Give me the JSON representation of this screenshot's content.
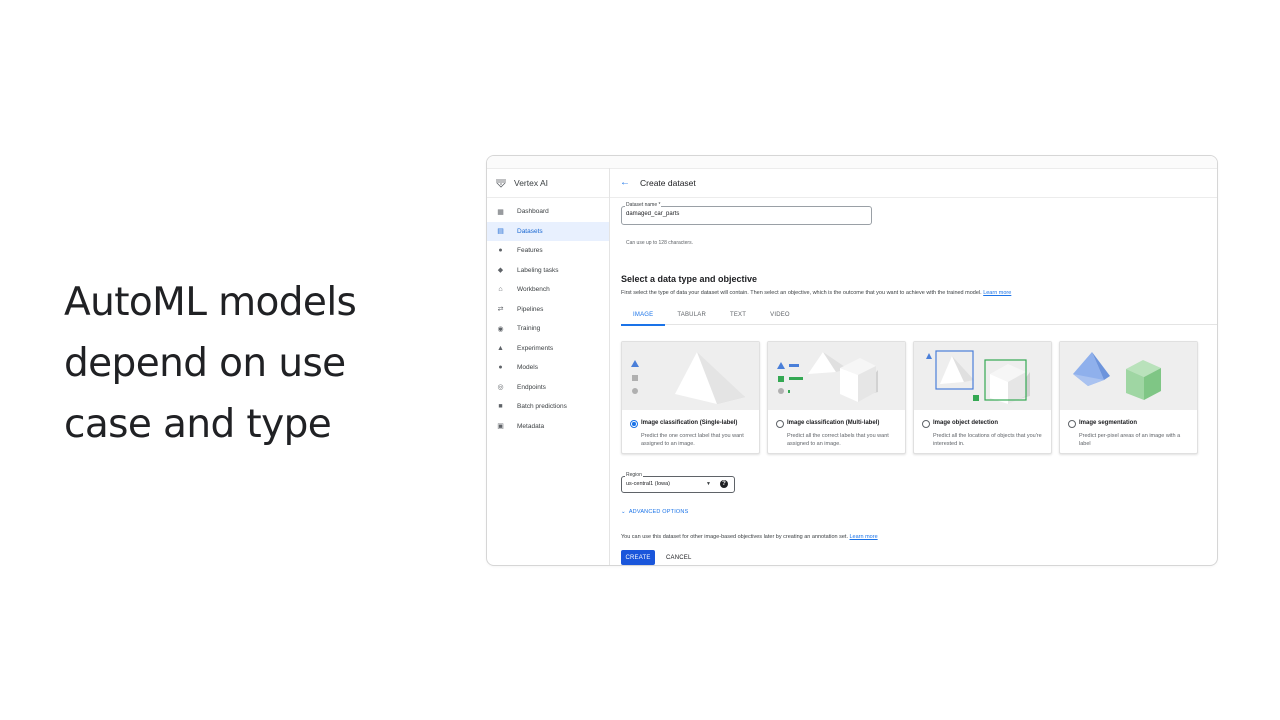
{
  "slide": {
    "headline_lines": [
      "AutoML models",
      "depend on use",
      "case and type"
    ]
  },
  "app": {
    "title": "Vertex AI",
    "accent_color": "#1a73e8"
  },
  "sidebar": {
    "items": [
      {
        "label": "Dashboard",
        "icon": "dashboard-icon"
      },
      {
        "label": "Datasets",
        "icon": "datasets-icon",
        "active": true
      },
      {
        "label": "Features",
        "icon": "features-icon"
      },
      {
        "label": "Labeling tasks",
        "icon": "label-icon"
      },
      {
        "label": "Workbench",
        "icon": "workbench-icon"
      },
      {
        "label": "Pipelines",
        "icon": "pipelines-icon"
      },
      {
        "label": "Training",
        "icon": "training-icon"
      },
      {
        "label": "Experiments",
        "icon": "experiments-icon"
      },
      {
        "label": "Models",
        "icon": "models-icon"
      },
      {
        "label": "Endpoints",
        "icon": "endpoints-icon"
      },
      {
        "label": "Batch predictions",
        "icon": "batch-icon"
      },
      {
        "label": "Metadata",
        "icon": "metadata-icon"
      }
    ]
  },
  "header": {
    "back_icon": "arrow-back-icon",
    "title": "Create dataset"
  },
  "dataset_name": {
    "label": "Dataset name *",
    "value": "damaged_car_parts",
    "hint": "Can use up to 128 characters."
  },
  "section": {
    "title": "Select a data type and objective",
    "description": "First select the type of data your dataset will contain. Then select an objective, which is the outcome that you want to achieve with the trained model.",
    "learn_more": "Learn more"
  },
  "tabs": [
    "IMAGE",
    "TABULAR",
    "TEXT",
    "VIDEO"
  ],
  "cards": [
    {
      "title": "Image classification (Single-label)",
      "description": "Predict the one correct label that you want assigned to an image.",
      "selected": true
    },
    {
      "title": "Image classification (Multi-label)",
      "description": "Predict all the correct labels that you want assigned to an image.",
      "selected": false
    },
    {
      "title": "Image object detection",
      "description": "Predict all the locations of objects that you're interested in.",
      "selected": false
    },
    {
      "title": "Image segmentation",
      "description": "Predict per-pixel areas of an image with a label",
      "selected": false
    }
  ],
  "region": {
    "label": "Region",
    "value": "us-central1 (Iowa)"
  },
  "advanced_options": "ADVANCED OPTIONS",
  "note": {
    "text": "You can use this dataset for other image-based objectives later by creating an annotation set.",
    "learn_more": "Learn more"
  },
  "buttons": {
    "create": "CREATE",
    "cancel": "CANCEL"
  }
}
